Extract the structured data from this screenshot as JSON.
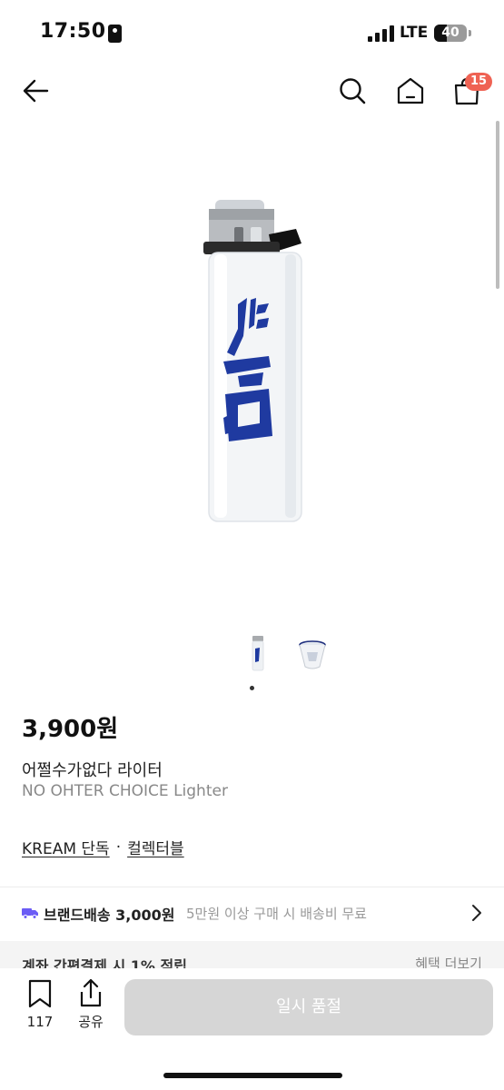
{
  "status_bar": {
    "time": "17:50",
    "network": "LTE",
    "battery": "40",
    "battery_level": 0.4
  },
  "nav": {
    "back_icon": "arrow-left-icon",
    "search_icon": "search-icon",
    "home_icon": "home-icon",
    "cart_icon": "shopping-bag-icon",
    "cart_count": "15"
  },
  "product": {
    "image": "white-lighter-with-blue-calligraphy",
    "thumbnails": [
      "lighter-thumbnail",
      "shot-glass-thumbnail"
    ],
    "price": "3,900원",
    "name_ko": "어쩔수가없다 라이터",
    "name_en": "NO OHTER CHOICE Lighter",
    "tags": [
      "KREAM 단독",
      "컬렉터블"
    ],
    "tag_separator": "·"
  },
  "shipping": {
    "title": "브랜드배송 3,000원",
    "note": "5만원 이상 구매 시 배송비 무료",
    "icon_color": "#6b5cf5"
  },
  "promo": {
    "left": "계좌 간편결제 시 1% 적립",
    "right": "혜택 더보기"
  },
  "bottom_bar": {
    "bookmark_count": "117",
    "share_label": "공유",
    "action_label": "일시 품절"
  }
}
